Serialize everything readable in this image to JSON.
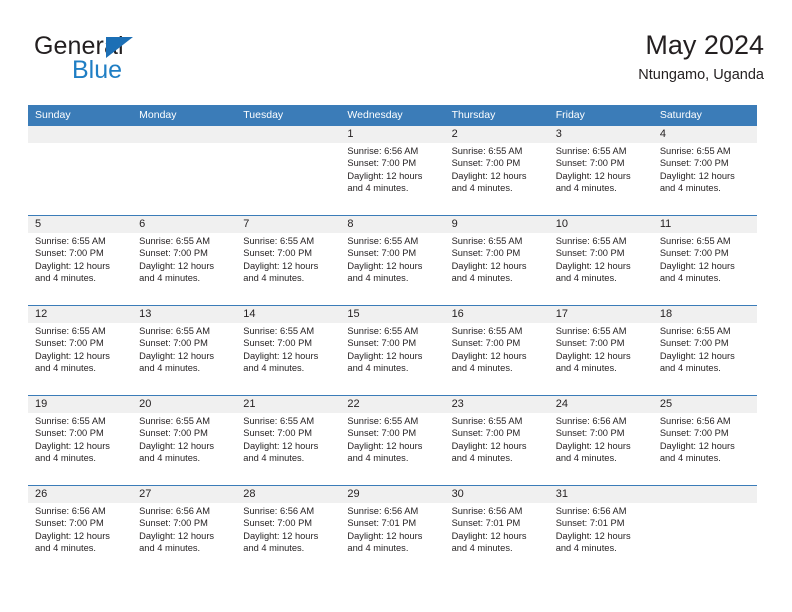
{
  "brand": {
    "word1": "General",
    "word2": "Blue",
    "triangle_color": "#1c6fb5",
    "blue_color": "#1f7ec4"
  },
  "header": {
    "title": "May 2024",
    "subtitle": "Ntungamo, Uganda"
  },
  "theme": {
    "header_band": "#3b7cb8",
    "day_number_band": "#f0f0f0",
    "text": "#231f20",
    "header_text": "#ffffff"
  },
  "weekdays": [
    "Sunday",
    "Monday",
    "Tuesday",
    "Wednesday",
    "Thursday",
    "Friday",
    "Saturday"
  ],
  "weeks": [
    {
      "days": [
        {
          "num": "",
          "empty": true,
          "l1": "",
          "l2": "",
          "l3": "",
          "l4": ""
        },
        {
          "num": "",
          "empty": true,
          "l1": "",
          "l2": "",
          "l3": "",
          "l4": ""
        },
        {
          "num": "",
          "empty": true,
          "l1": "",
          "l2": "",
          "l3": "",
          "l4": ""
        },
        {
          "num": "1",
          "empty": false,
          "l1": "Sunrise: 6:56 AM",
          "l2": "Sunset: 7:00 PM",
          "l3": "Daylight: 12 hours",
          "l4": "and 4 minutes."
        },
        {
          "num": "2",
          "empty": false,
          "l1": "Sunrise: 6:55 AM",
          "l2": "Sunset: 7:00 PM",
          "l3": "Daylight: 12 hours",
          "l4": "and 4 minutes."
        },
        {
          "num": "3",
          "empty": false,
          "l1": "Sunrise: 6:55 AM",
          "l2": "Sunset: 7:00 PM",
          "l3": "Daylight: 12 hours",
          "l4": "and 4 minutes."
        },
        {
          "num": "4",
          "empty": false,
          "l1": "Sunrise: 6:55 AM",
          "l2": "Sunset: 7:00 PM",
          "l3": "Daylight: 12 hours",
          "l4": "and 4 minutes."
        }
      ]
    },
    {
      "days": [
        {
          "num": "5",
          "empty": false,
          "l1": "Sunrise: 6:55 AM",
          "l2": "Sunset: 7:00 PM",
          "l3": "Daylight: 12 hours",
          "l4": "and 4 minutes."
        },
        {
          "num": "6",
          "empty": false,
          "l1": "Sunrise: 6:55 AM",
          "l2": "Sunset: 7:00 PM",
          "l3": "Daylight: 12 hours",
          "l4": "and 4 minutes."
        },
        {
          "num": "7",
          "empty": false,
          "l1": "Sunrise: 6:55 AM",
          "l2": "Sunset: 7:00 PM",
          "l3": "Daylight: 12 hours",
          "l4": "and 4 minutes."
        },
        {
          "num": "8",
          "empty": false,
          "l1": "Sunrise: 6:55 AM",
          "l2": "Sunset: 7:00 PM",
          "l3": "Daylight: 12 hours",
          "l4": "and 4 minutes."
        },
        {
          "num": "9",
          "empty": false,
          "l1": "Sunrise: 6:55 AM",
          "l2": "Sunset: 7:00 PM",
          "l3": "Daylight: 12 hours",
          "l4": "and 4 minutes."
        },
        {
          "num": "10",
          "empty": false,
          "l1": "Sunrise: 6:55 AM",
          "l2": "Sunset: 7:00 PM",
          "l3": "Daylight: 12 hours",
          "l4": "and 4 minutes."
        },
        {
          "num": "11",
          "empty": false,
          "l1": "Sunrise: 6:55 AM",
          "l2": "Sunset: 7:00 PM",
          "l3": "Daylight: 12 hours",
          "l4": "and 4 minutes."
        }
      ]
    },
    {
      "days": [
        {
          "num": "12",
          "empty": false,
          "l1": "Sunrise: 6:55 AM",
          "l2": "Sunset: 7:00 PM",
          "l3": "Daylight: 12 hours",
          "l4": "and 4 minutes."
        },
        {
          "num": "13",
          "empty": false,
          "l1": "Sunrise: 6:55 AM",
          "l2": "Sunset: 7:00 PM",
          "l3": "Daylight: 12 hours",
          "l4": "and 4 minutes."
        },
        {
          "num": "14",
          "empty": false,
          "l1": "Sunrise: 6:55 AM",
          "l2": "Sunset: 7:00 PM",
          "l3": "Daylight: 12 hours",
          "l4": "and 4 minutes."
        },
        {
          "num": "15",
          "empty": false,
          "l1": "Sunrise: 6:55 AM",
          "l2": "Sunset: 7:00 PM",
          "l3": "Daylight: 12 hours",
          "l4": "and 4 minutes."
        },
        {
          "num": "16",
          "empty": false,
          "l1": "Sunrise: 6:55 AM",
          "l2": "Sunset: 7:00 PM",
          "l3": "Daylight: 12 hours",
          "l4": "and 4 minutes."
        },
        {
          "num": "17",
          "empty": false,
          "l1": "Sunrise: 6:55 AM",
          "l2": "Sunset: 7:00 PM",
          "l3": "Daylight: 12 hours",
          "l4": "and 4 minutes."
        },
        {
          "num": "18",
          "empty": false,
          "l1": "Sunrise: 6:55 AM",
          "l2": "Sunset: 7:00 PM",
          "l3": "Daylight: 12 hours",
          "l4": "and 4 minutes."
        }
      ]
    },
    {
      "days": [
        {
          "num": "19",
          "empty": false,
          "l1": "Sunrise: 6:55 AM",
          "l2": "Sunset: 7:00 PM",
          "l3": "Daylight: 12 hours",
          "l4": "and 4 minutes."
        },
        {
          "num": "20",
          "empty": false,
          "l1": "Sunrise: 6:55 AM",
          "l2": "Sunset: 7:00 PM",
          "l3": "Daylight: 12 hours",
          "l4": "and 4 minutes."
        },
        {
          "num": "21",
          "empty": false,
          "l1": "Sunrise: 6:55 AM",
          "l2": "Sunset: 7:00 PM",
          "l3": "Daylight: 12 hours",
          "l4": "and 4 minutes."
        },
        {
          "num": "22",
          "empty": false,
          "l1": "Sunrise: 6:55 AM",
          "l2": "Sunset: 7:00 PM",
          "l3": "Daylight: 12 hours",
          "l4": "and 4 minutes."
        },
        {
          "num": "23",
          "empty": false,
          "l1": "Sunrise: 6:55 AM",
          "l2": "Sunset: 7:00 PM",
          "l3": "Daylight: 12 hours",
          "l4": "and 4 minutes."
        },
        {
          "num": "24",
          "empty": false,
          "l1": "Sunrise: 6:56 AM",
          "l2": "Sunset: 7:00 PM",
          "l3": "Daylight: 12 hours",
          "l4": "and 4 minutes."
        },
        {
          "num": "25",
          "empty": false,
          "l1": "Sunrise: 6:56 AM",
          "l2": "Sunset: 7:00 PM",
          "l3": "Daylight: 12 hours",
          "l4": "and 4 minutes."
        }
      ]
    },
    {
      "days": [
        {
          "num": "26",
          "empty": false,
          "l1": "Sunrise: 6:56 AM",
          "l2": "Sunset: 7:00 PM",
          "l3": "Daylight: 12 hours",
          "l4": "and 4 minutes."
        },
        {
          "num": "27",
          "empty": false,
          "l1": "Sunrise: 6:56 AM",
          "l2": "Sunset: 7:00 PM",
          "l3": "Daylight: 12 hours",
          "l4": "and 4 minutes."
        },
        {
          "num": "28",
          "empty": false,
          "l1": "Sunrise: 6:56 AM",
          "l2": "Sunset: 7:00 PM",
          "l3": "Daylight: 12 hours",
          "l4": "and 4 minutes."
        },
        {
          "num": "29",
          "empty": false,
          "l1": "Sunrise: 6:56 AM",
          "l2": "Sunset: 7:01 PM",
          "l3": "Daylight: 12 hours",
          "l4": "and 4 minutes."
        },
        {
          "num": "30",
          "empty": false,
          "l1": "Sunrise: 6:56 AM",
          "l2": "Sunset: 7:01 PM",
          "l3": "Daylight: 12 hours",
          "l4": "and 4 minutes."
        },
        {
          "num": "31",
          "empty": false,
          "l1": "Sunrise: 6:56 AM",
          "l2": "Sunset: 7:01 PM",
          "l3": "Daylight: 12 hours",
          "l4": "and 4 minutes."
        },
        {
          "num": "",
          "empty": true,
          "l1": "",
          "l2": "",
          "l3": "",
          "l4": ""
        }
      ]
    }
  ]
}
